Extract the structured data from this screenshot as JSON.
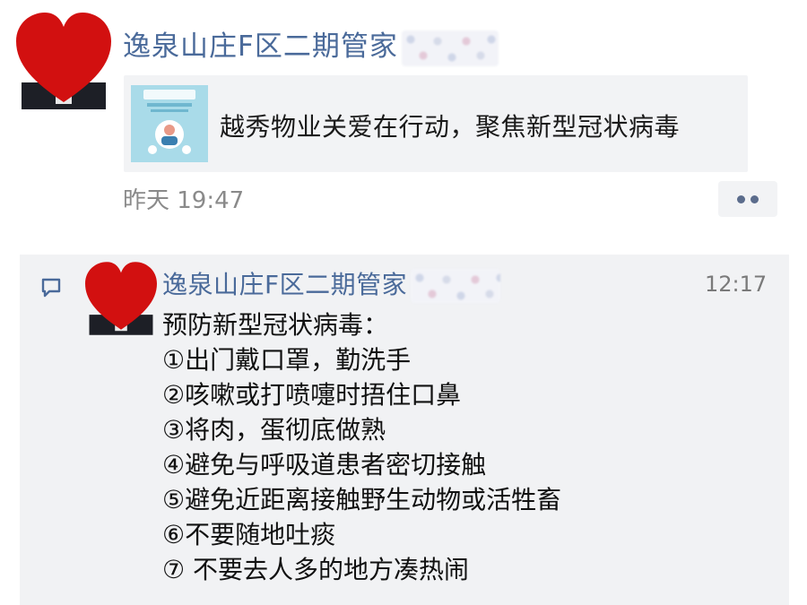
{
  "post": {
    "poster_name": "逸泉山庄F区二期管家",
    "share_title": "越秀物业关爱在行动，聚焦新型冠状病毒",
    "time": "昨天 19:47"
  },
  "chat": {
    "sender": "逸泉山庄F区二期管家",
    "time": "12:17",
    "lines": [
      "预防新型冠状病毒：",
      "①出门戴口罩，勤洗手",
      "②咳嗽或打喷嚏时捂住口鼻",
      "③将肉，蛋彻底做熟",
      "④避免与呼吸道患者密切接触",
      "⑤避免近距离接触野生动物或活牲畜",
      "⑥不要随地吐痰",
      "⑦ 不要去人多的地方凑热闹"
    ]
  },
  "colors": {
    "name_link": "#4a6a9a",
    "heart": "#d21010",
    "panel_bg": "#f1f2f4"
  },
  "icons": [
    "heart-avatar-icon",
    "chat-bubble-icon",
    "more-dots-icon"
  ]
}
